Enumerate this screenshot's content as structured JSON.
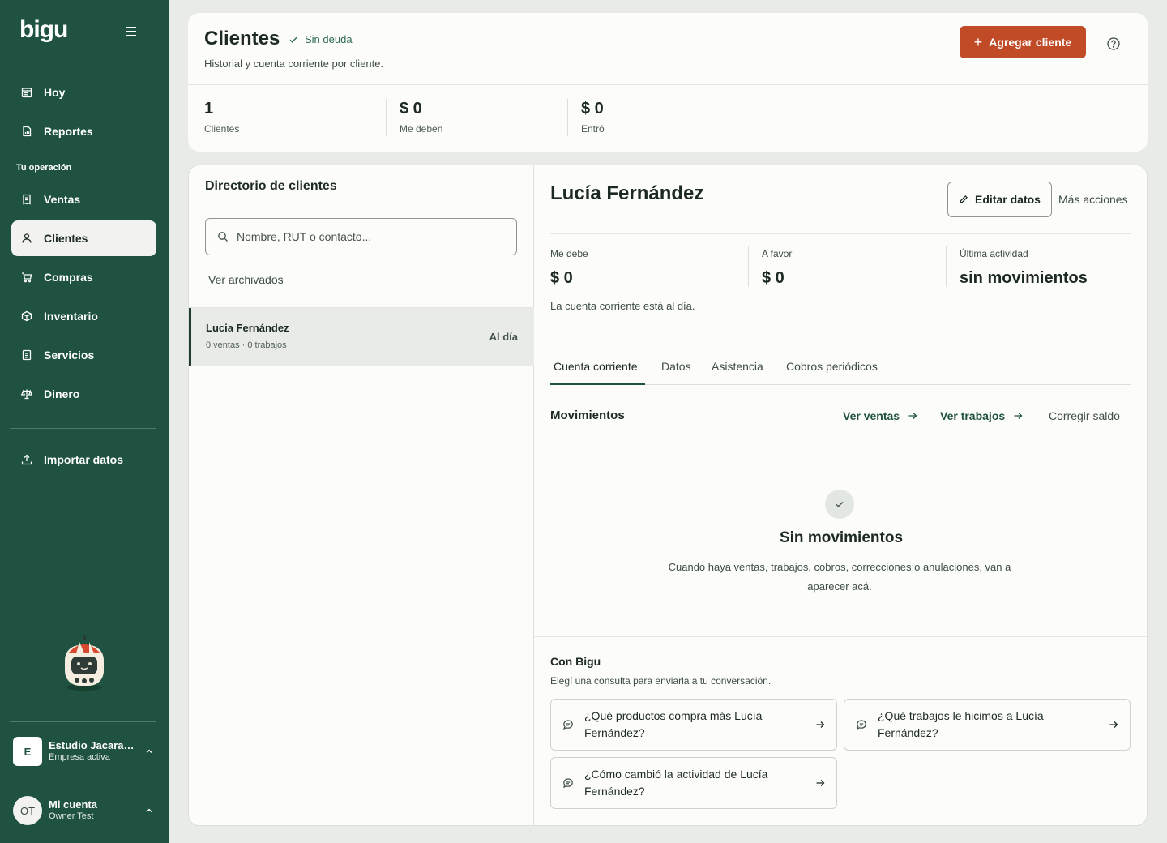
{
  "app": {
    "logo": "bigu"
  },
  "sidebar": {
    "items_top": [
      {
        "label": "Hoy",
        "icon": "calendar-icon"
      },
      {
        "label": "Reportes",
        "icon": "report-icon"
      }
    ],
    "section_label": "Tu operación",
    "items": [
      {
        "label": "Ventas",
        "icon": "receipt-icon"
      },
      {
        "label": "Clientes",
        "icon": "user-icon",
        "active": true
      },
      {
        "label": "Compras",
        "icon": "cart-icon"
      },
      {
        "label": "Inventario",
        "icon": "box-icon"
      },
      {
        "label": "Servicios",
        "icon": "document-icon"
      },
      {
        "label": "Dinero",
        "icon": "scale-icon"
      }
    ],
    "import": {
      "label": "Importar datos",
      "icon": "upload-icon"
    },
    "company": {
      "initial": "E",
      "name": "Estudio Jacara…",
      "status": "Empresa activa"
    },
    "account": {
      "initials": "OT",
      "title": "Mi cuenta",
      "user": "Owner Test"
    }
  },
  "header": {
    "title": "Clientes",
    "badge": "Sin deuda",
    "subtitle": "Historial y cuenta corriente por cliente.",
    "add_label": "Agregar cliente",
    "stats": [
      {
        "value": "1",
        "label": "Clientes"
      },
      {
        "value": "$ 0",
        "label": "Me deben"
      },
      {
        "value": "$ 0",
        "label": "Entró"
      }
    ]
  },
  "directory": {
    "title": "Directorio de clientes",
    "search_placeholder": "Nombre, RUT o contacto...",
    "archived_label": "Ver archivados",
    "clients": [
      {
        "name": "Lucia Fernández",
        "summary": "0 ventas · 0 trabajos",
        "status": "Al día"
      }
    ]
  },
  "detail": {
    "name": "Lucía Fernández",
    "edit_label": "Editar datos",
    "more_label": "Más acciones",
    "balances": [
      {
        "label": "Me debe",
        "value": "$ 0"
      },
      {
        "label": "A favor",
        "value": "$ 0"
      },
      {
        "label": "Última actividad",
        "value": "sin movimientos"
      }
    ],
    "status_line": "La cuenta corriente está al día.",
    "tabs": [
      "Cuenta corriente",
      "Datos",
      "Asistencia",
      "Cobros periódicos"
    ],
    "movements": {
      "title": "Movimientos",
      "links": [
        "Ver ventas",
        "Ver trabajos"
      ],
      "correct_label": "Corregir saldo",
      "empty_title": "Sin movimientos",
      "empty_desc": "Cuando haya ventas, trabajos, cobros, correcciones o anulaciones, van a aparecer acá."
    },
    "bigu": {
      "title": "Con Bigu",
      "subtitle": "Elegí una consulta para enviarla a tu conversación.",
      "questions": [
        "¿Qué productos compra más Lucía Fernández?",
        "¿Qué trabajos le hicimos a Lucía Fernández?",
        "¿Cómo cambió la actividad de Lucía Fernández?"
      ]
    }
  },
  "colors": {
    "sidebar": "#1f5240",
    "accent": "#c24b27",
    "background": "#e8ebe6"
  }
}
